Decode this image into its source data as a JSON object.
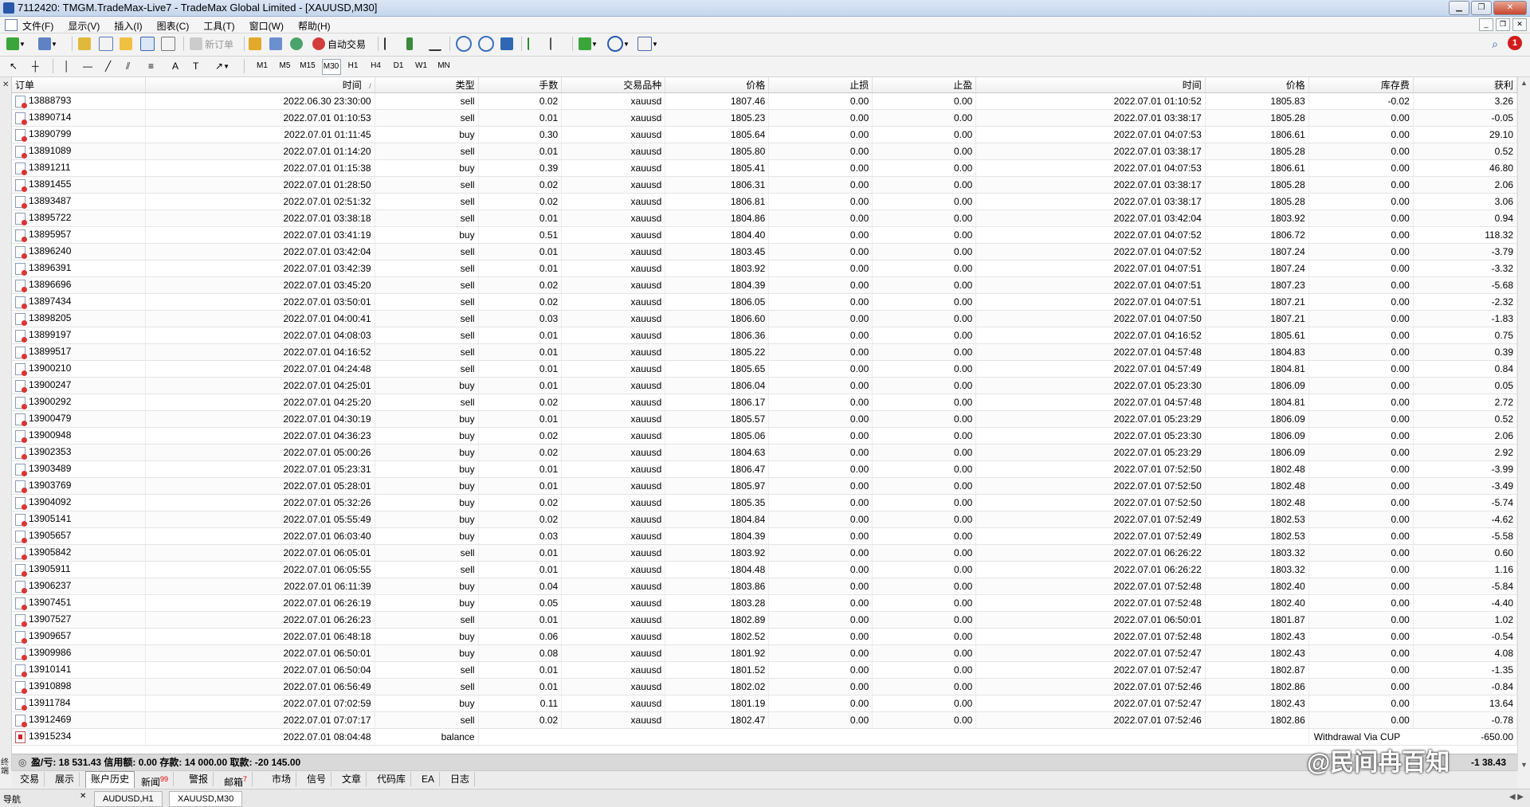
{
  "window": {
    "title": "7112420: TMGM.TradeMax-Live7 - TradeMax Global Limited - [XAUUSD,M30]"
  },
  "menu": [
    "文件(F)",
    "显示(V)",
    "插入(I)",
    "图表(C)",
    "工具(T)",
    "窗口(W)",
    "帮助(H)"
  ],
  "toolbar": {
    "new_order": "新订单",
    "auto_trading": "自动交易",
    "notification_count": "1"
  },
  "timeframes": [
    "M1",
    "M5",
    "M15",
    "M30",
    "H1",
    "H4",
    "D1",
    "W1",
    "MN"
  ],
  "active_timeframe": "M30",
  "columns": {
    "order": "订单",
    "time": "时间",
    "sort": "/",
    "type": "类型",
    "lots": "手数",
    "symbol": "交易品种",
    "price": "价格",
    "sl": "止损",
    "tp": "止盈",
    "close_time": "时间",
    "close_price": "价格",
    "swap": "库存费",
    "profit": "获利"
  },
  "rows": [
    [
      "13888793",
      "2022.06.30 23:30:00",
      "sell",
      "0.02",
      "xauusd",
      "1807.46",
      "0.00",
      "0.00",
      "2022.07.01 01:10:52",
      "1805.83",
      "-0.02",
      "3.26"
    ],
    [
      "13890714",
      "2022.07.01 01:10:53",
      "sell",
      "0.01",
      "xauusd",
      "1805.23",
      "0.00",
      "0.00",
      "2022.07.01 03:38:17",
      "1805.28",
      "0.00",
      "-0.05"
    ],
    [
      "13890799",
      "2022.07.01 01:11:45",
      "buy",
      "0.30",
      "xauusd",
      "1805.64",
      "0.00",
      "0.00",
      "2022.07.01 04:07:53",
      "1806.61",
      "0.00",
      "29.10"
    ],
    [
      "13891089",
      "2022.07.01 01:14:20",
      "sell",
      "0.01",
      "xauusd",
      "1805.80",
      "0.00",
      "0.00",
      "2022.07.01 03:38:17",
      "1805.28",
      "0.00",
      "0.52"
    ],
    [
      "13891211",
      "2022.07.01 01:15:38",
      "buy",
      "0.39",
      "xauusd",
      "1805.41",
      "0.00",
      "0.00",
      "2022.07.01 04:07:53",
      "1806.61",
      "0.00",
      "46.80"
    ],
    [
      "13891455",
      "2022.07.01 01:28:50",
      "sell",
      "0.02",
      "xauusd",
      "1806.31",
      "0.00",
      "0.00",
      "2022.07.01 03:38:17",
      "1805.28",
      "0.00",
      "2.06"
    ],
    [
      "13893487",
      "2022.07.01 02:51:32",
      "sell",
      "0.02",
      "xauusd",
      "1806.81",
      "0.00",
      "0.00",
      "2022.07.01 03:38:17",
      "1805.28",
      "0.00",
      "3.06"
    ],
    [
      "13895722",
      "2022.07.01 03:38:18",
      "sell",
      "0.01",
      "xauusd",
      "1804.86",
      "0.00",
      "0.00",
      "2022.07.01 03:42:04",
      "1803.92",
      "0.00",
      "0.94"
    ],
    [
      "13895957",
      "2022.07.01 03:41:19",
      "buy",
      "0.51",
      "xauusd",
      "1804.40",
      "0.00",
      "0.00",
      "2022.07.01 04:07:52",
      "1806.72",
      "0.00",
      "118.32"
    ],
    [
      "13896240",
      "2022.07.01 03:42:04",
      "sell",
      "0.01",
      "xauusd",
      "1803.45",
      "0.00",
      "0.00",
      "2022.07.01 04:07:52",
      "1807.24",
      "0.00",
      "-3.79"
    ],
    [
      "13896391",
      "2022.07.01 03:42:39",
      "sell",
      "0.01",
      "xauusd",
      "1803.92",
      "0.00",
      "0.00",
      "2022.07.01 04:07:51",
      "1807.24",
      "0.00",
      "-3.32"
    ],
    [
      "13896696",
      "2022.07.01 03:45:20",
      "sell",
      "0.02",
      "xauusd",
      "1804.39",
      "0.00",
      "0.00",
      "2022.07.01 04:07:51",
      "1807.23",
      "0.00",
      "-5.68"
    ],
    [
      "13897434",
      "2022.07.01 03:50:01",
      "sell",
      "0.02",
      "xauusd",
      "1806.05",
      "0.00",
      "0.00",
      "2022.07.01 04:07:51",
      "1807.21",
      "0.00",
      "-2.32"
    ],
    [
      "13898205",
      "2022.07.01 04:00:41",
      "sell",
      "0.03",
      "xauusd",
      "1806.60",
      "0.00",
      "0.00",
      "2022.07.01 04:07:50",
      "1807.21",
      "0.00",
      "-1.83"
    ],
    [
      "13899197",
      "2022.07.01 04:08:03",
      "sell",
      "0.01",
      "xauusd",
      "1806.36",
      "0.00",
      "0.00",
      "2022.07.01 04:16:52",
      "1805.61",
      "0.00",
      "0.75"
    ],
    [
      "13899517",
      "2022.07.01 04:16:52",
      "sell",
      "0.01",
      "xauusd",
      "1805.22",
      "0.00",
      "0.00",
      "2022.07.01 04:57:48",
      "1804.83",
      "0.00",
      "0.39"
    ],
    [
      "13900210",
      "2022.07.01 04:24:48",
      "sell",
      "0.01",
      "xauusd",
      "1805.65",
      "0.00",
      "0.00",
      "2022.07.01 04:57:49",
      "1804.81",
      "0.00",
      "0.84"
    ],
    [
      "13900247",
      "2022.07.01 04:25:01",
      "buy",
      "0.01",
      "xauusd",
      "1806.04",
      "0.00",
      "0.00",
      "2022.07.01 05:23:30",
      "1806.09",
      "0.00",
      "0.05"
    ],
    [
      "13900292",
      "2022.07.01 04:25:20",
      "sell",
      "0.02",
      "xauusd",
      "1806.17",
      "0.00",
      "0.00",
      "2022.07.01 04:57:48",
      "1804.81",
      "0.00",
      "2.72"
    ],
    [
      "13900479",
      "2022.07.01 04:30:19",
      "buy",
      "0.01",
      "xauusd",
      "1805.57",
      "0.00",
      "0.00",
      "2022.07.01 05:23:29",
      "1806.09",
      "0.00",
      "0.52"
    ],
    [
      "13900948",
      "2022.07.01 04:36:23",
      "buy",
      "0.02",
      "xauusd",
      "1805.06",
      "0.00",
      "0.00",
      "2022.07.01 05:23:30",
      "1806.09",
      "0.00",
      "2.06"
    ],
    [
      "13902353",
      "2022.07.01 05:00:26",
      "buy",
      "0.02",
      "xauusd",
      "1804.63",
      "0.00",
      "0.00",
      "2022.07.01 05:23:29",
      "1806.09",
      "0.00",
      "2.92"
    ],
    [
      "13903489",
      "2022.07.01 05:23:31",
      "buy",
      "0.01",
      "xauusd",
      "1806.47",
      "0.00",
      "0.00",
      "2022.07.01 07:52:50",
      "1802.48",
      "0.00",
      "-3.99"
    ],
    [
      "13903769",
      "2022.07.01 05:28:01",
      "buy",
      "0.01",
      "xauusd",
      "1805.97",
      "0.00",
      "0.00",
      "2022.07.01 07:52:50",
      "1802.48",
      "0.00",
      "-3.49"
    ],
    [
      "13904092",
      "2022.07.01 05:32:26",
      "buy",
      "0.02",
      "xauusd",
      "1805.35",
      "0.00",
      "0.00",
      "2022.07.01 07:52:50",
      "1802.48",
      "0.00",
      "-5.74"
    ],
    [
      "13905141",
      "2022.07.01 05:55:49",
      "buy",
      "0.02",
      "xauusd",
      "1804.84",
      "0.00",
      "0.00",
      "2022.07.01 07:52:49",
      "1802.53",
      "0.00",
      "-4.62"
    ],
    [
      "13905657",
      "2022.07.01 06:03:40",
      "buy",
      "0.03",
      "xauusd",
      "1804.39",
      "0.00",
      "0.00",
      "2022.07.01 07:52:49",
      "1802.53",
      "0.00",
      "-5.58"
    ],
    [
      "13905842",
      "2022.07.01 06:05:01",
      "sell",
      "0.01",
      "xauusd",
      "1803.92",
      "0.00",
      "0.00",
      "2022.07.01 06:26:22",
      "1803.32",
      "0.00",
      "0.60"
    ],
    [
      "13905911",
      "2022.07.01 06:05:55",
      "sell",
      "0.01",
      "xauusd",
      "1804.48",
      "0.00",
      "0.00",
      "2022.07.01 06:26:22",
      "1803.32",
      "0.00",
      "1.16"
    ],
    [
      "13906237",
      "2022.07.01 06:11:39",
      "buy",
      "0.04",
      "xauusd",
      "1803.86",
      "0.00",
      "0.00",
      "2022.07.01 07:52:48",
      "1802.40",
      "0.00",
      "-5.84"
    ],
    [
      "13907451",
      "2022.07.01 06:26:19",
      "buy",
      "0.05",
      "xauusd",
      "1803.28",
      "0.00",
      "0.00",
      "2022.07.01 07:52:48",
      "1802.40",
      "0.00",
      "-4.40"
    ],
    [
      "13907527",
      "2022.07.01 06:26:23",
      "sell",
      "0.01",
      "xauusd",
      "1802.89",
      "0.00",
      "0.00",
      "2022.07.01 06:50:01",
      "1801.87",
      "0.00",
      "1.02"
    ],
    [
      "13909657",
      "2022.07.01 06:48:18",
      "buy",
      "0.06",
      "xauusd",
      "1802.52",
      "0.00",
      "0.00",
      "2022.07.01 07:52:48",
      "1802.43",
      "0.00",
      "-0.54"
    ],
    [
      "13909986",
      "2022.07.01 06:50:01",
      "buy",
      "0.08",
      "xauusd",
      "1801.92",
      "0.00",
      "0.00",
      "2022.07.01 07:52:47",
      "1802.43",
      "0.00",
      "4.08"
    ],
    [
      "13910141",
      "2022.07.01 06:50:04",
      "sell",
      "0.01",
      "xauusd",
      "1801.52",
      "0.00",
      "0.00",
      "2022.07.01 07:52:47",
      "1802.87",
      "0.00",
      "-1.35"
    ],
    [
      "13910898",
      "2022.07.01 06:56:49",
      "sell",
      "0.01",
      "xauusd",
      "1802.02",
      "0.00",
      "0.00",
      "2022.07.01 07:52:46",
      "1802.86",
      "0.00",
      "-0.84"
    ],
    [
      "13911784",
      "2022.07.01 07:02:59",
      "buy",
      "0.11",
      "xauusd",
      "1801.19",
      "0.00",
      "0.00",
      "2022.07.01 07:52:47",
      "1802.43",
      "0.00",
      "13.64"
    ],
    [
      "13912469",
      "2022.07.01 07:07:17",
      "sell",
      "0.02",
      "xauusd",
      "1802.47",
      "0.00",
      "0.00",
      "2022.07.01 07:52:46",
      "1802.86",
      "0.00",
      "-0.78"
    ]
  ],
  "balance_row": {
    "order": "13915234",
    "time": "2022.07.01 08:04:48",
    "type": "balance",
    "comment": "Withdrawal Via CUP",
    "profit": "-650.00"
  },
  "summary": {
    "text": "盈/亏: 18 531.43  信用额: 0.00  存款: 14 000.00  取款: -20 145.00",
    "right": "-1 38.43"
  },
  "tabs": [
    {
      "label": "交易"
    },
    {
      "label": "展示"
    },
    {
      "label": "账户历史",
      "active": true
    },
    {
      "label": "新闻",
      "badge": "99"
    },
    {
      "label": "警报"
    },
    {
      "label": "邮箱",
      "badge": "7"
    },
    {
      "label": "市场"
    },
    {
      "label": "信号"
    },
    {
      "label": "文章"
    },
    {
      "label": "代码库"
    },
    {
      "label": "EA"
    },
    {
      "label": "日志"
    }
  ],
  "side_label": "终端",
  "navigator_label": "导航",
  "chart_tabs": [
    "AUDUSD,H1",
    "XAUUSD,M30"
  ],
  "active_chart_tab": "XAUUSD,M30",
  "watermark": "@民间冉百知"
}
